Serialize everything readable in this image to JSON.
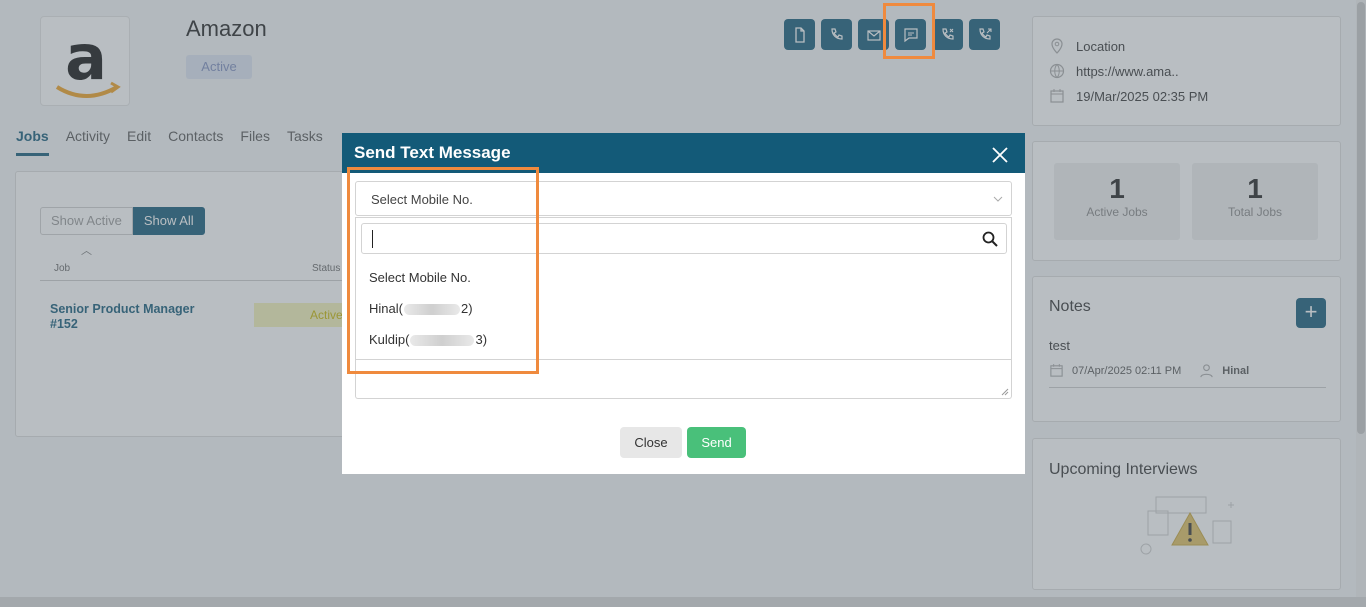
{
  "company": {
    "name": "Amazon",
    "status": "Active"
  },
  "tabs": [
    "Jobs",
    "Activity",
    "Edit",
    "Contacts",
    "Files",
    "Tasks"
  ],
  "jobs_panel": {
    "show_active": "Show Active",
    "show_all": "Show All",
    "col_job": "Job",
    "col_status": "Status",
    "rows": [
      {
        "title": "Senior Product Manager #152",
        "status": "Active"
      }
    ]
  },
  "info": {
    "location": "Location",
    "website": "https://www.ama..",
    "created": "19/Mar/2025 02:35 PM"
  },
  "stats": [
    {
      "value": "1",
      "label": "Active Jobs"
    },
    {
      "value": "1",
      "label": "Total Jobs"
    }
  ],
  "notes": {
    "title": "Notes",
    "add": "+",
    "items": [
      {
        "text": "test",
        "date": "07/Apr/2025 02:11 PM",
        "author": "Hinal"
      }
    ]
  },
  "interviews": {
    "title": "Upcoming Interviews"
  },
  "modal": {
    "title": "Send Text Message",
    "select_value": "Select Mobile No.",
    "options": [
      {
        "label": "Select Mobile No."
      },
      {
        "prefix": "Hinal(",
        "suffix": "2)"
      },
      {
        "prefix": "Kuldip(",
        "suffix": "3)"
      }
    ],
    "close_label": "Close",
    "send_label": "Send"
  },
  "colors": {
    "primary": "#135a78",
    "send": "#49c07a",
    "highlight": "#ef8a3e"
  }
}
